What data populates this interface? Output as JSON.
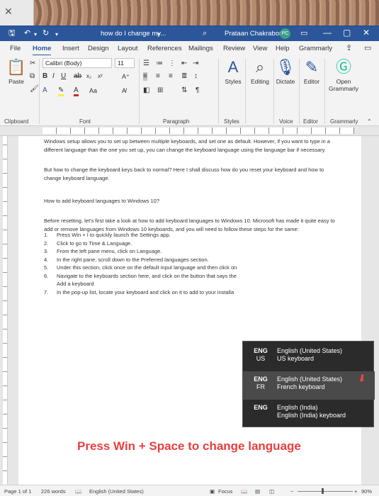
{
  "window": {
    "doc_title": "how do I change my...",
    "user_name": "Prataan Chakraborty",
    "user_initials": "PC"
  },
  "tabs": [
    "File",
    "Home",
    "Insert",
    "Design",
    "Layout",
    "References",
    "Mailings",
    "Review",
    "View",
    "Help",
    "Grammarly"
  ],
  "ribbon": {
    "paste_label": "Paste",
    "font_name": "Calibri (Body)",
    "font_size": "11",
    "styles_label": "Styles",
    "editing_label": "Editing",
    "dictate_label": "Dictate",
    "editor_label": "Editor",
    "grammarly_label_1": "Open",
    "grammarly_label_2": "Grammarly",
    "groups": {
      "clipboard": "Clipboard",
      "font": "Font",
      "paragraph": "Paragraph",
      "styles": "Styles",
      "voice": "Voice",
      "editor": "Editor",
      "grammarly": "Grammarly"
    }
  },
  "document": {
    "p1": "Windows setup allows you to set up between multiple keyboards, and set one as default. However, if you want to type in a different language than the one you set up, you can change the keyboard language using the language bar if necessary.",
    "p2": "But how to change the keyboard keys back to normal? Here I shall discuss how do you reset your keyboard and how to change keyboard language.",
    "p3": "How to add keyboard languages to Windows 10?",
    "p4": "Before resetting, let's first take a look at how to add keyboard languages to Windows 10. Microsoft has made it quite easy to add or remove languages from Windows 10 keyboards, and you will need to follow these steps for the same:",
    "steps": [
      {
        "num": "1.",
        "text": "Press Win + I to quickly launch the Settings app."
      },
      {
        "num": "2.",
        "text": "Click to go to Time & Language."
      },
      {
        "num": "3.",
        "text": "From the left pane menu, click on Language."
      },
      {
        "num": "4.",
        "text": "In the right pane, scroll down to the Preferred languages section."
      },
      {
        "num": "5.",
        "text": "Under this section, click once on the default input language and then click on"
      },
      {
        "num": "6.",
        "text": "Navigate to the keyboards section here, and click on the button that says the",
        "cont": "Add a keyboard"
      },
      {
        "num": "7.",
        "text": "In the pop-up list, locate your keyboard and click on it to add to your installa"
      }
    ],
    "caption": "Press Win + Space to change language"
  },
  "language_switcher": [
    {
      "code1": "ENG",
      "code2": "US",
      "line1": "English (United States)",
      "line2": "US keyboard"
    },
    {
      "code1": "ENG",
      "code2": "FR",
      "line1": "English (United States)",
      "line2": "French keyboard"
    },
    {
      "code1": "ENG",
      "code2": "",
      "line1": "English (India)",
      "line2": "English (India) keyboard"
    }
  ],
  "status": {
    "page": "Page 1 of 1",
    "words": "226 words",
    "language": "English (United States)",
    "focus": "Focus",
    "zoom_minus": "−",
    "zoom_plus": "+",
    "zoom": "90%",
    "zoom_level": 0.9
  }
}
